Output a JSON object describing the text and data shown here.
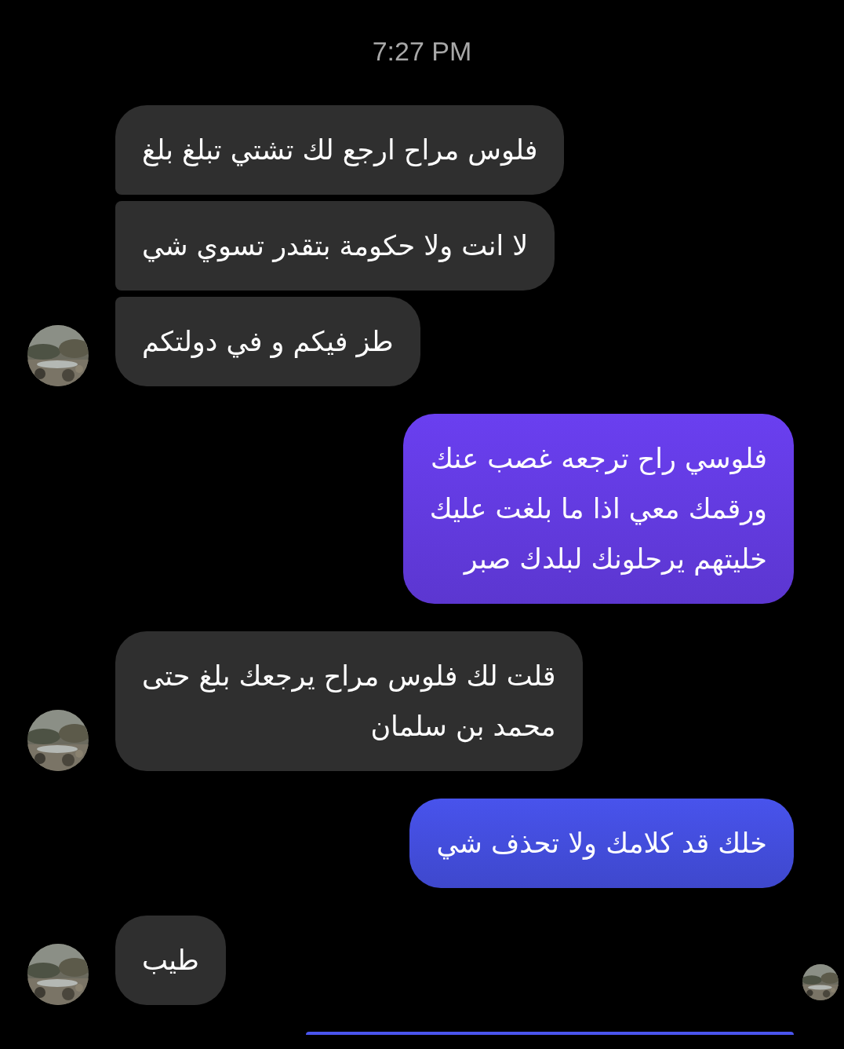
{
  "timestamp": "7:27 PM",
  "messages": [
    {
      "kind": "incoming",
      "text": "فلوس مراح ارجع لك تشتي تبلغ بلغ",
      "avatar": false
    },
    {
      "kind": "incoming",
      "text": "لا انت ولا حكومة بتقدر تسوي شي",
      "avatar": false
    },
    {
      "kind": "incoming",
      "text": "طز فيكم و في دولتكم",
      "avatar": true
    },
    {
      "kind": "outgoing",
      "text": "فلوسي راح ترجعه غصب عنك\nورقمك معي اذا ما بلغت عليك\nخليتهم يرحلونك لبلدك صبر",
      "color": "#6a3ff0"
    },
    {
      "kind": "incoming",
      "text": "قلت لك فلوس مراح يرجعك بلغ حتى\nمحمد بن سلمان",
      "avatar": true
    },
    {
      "kind": "outgoing",
      "text": "خلك قد كلامك ولا تحذف شي",
      "color": "#4853ec"
    },
    {
      "kind": "incoming",
      "text": "طيب",
      "avatar": true,
      "seen": true
    },
    {
      "kind": "partial",
      "color": "#4a55ee"
    }
  ]
}
